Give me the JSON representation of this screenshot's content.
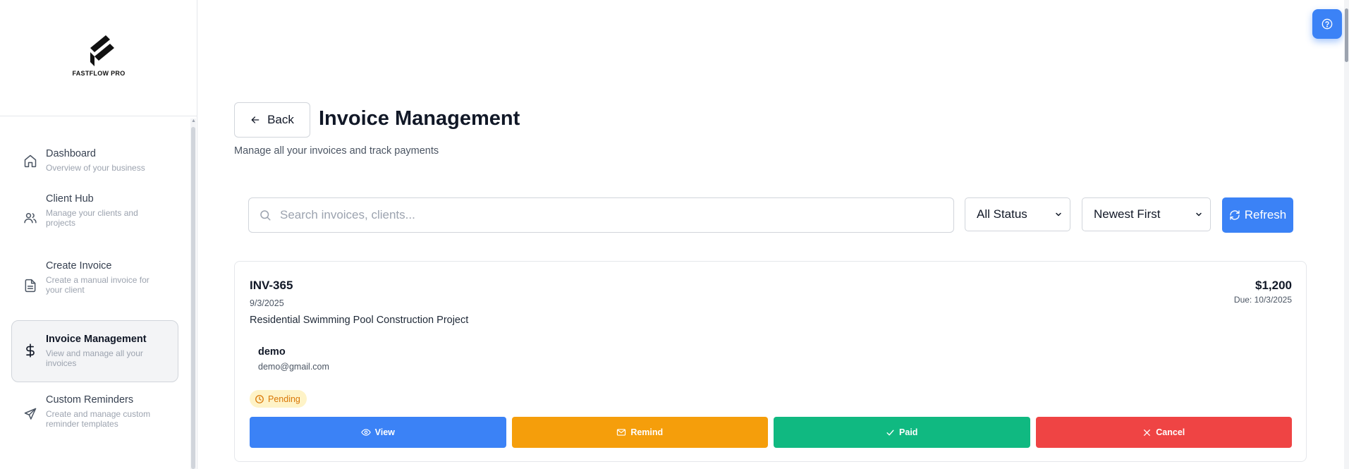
{
  "brand": {
    "name": "FASTFLOW PRO"
  },
  "sidebar": {
    "items": [
      {
        "title": "Dashboard",
        "desc": "Overview of your business",
        "icon": "home-icon",
        "active": false
      },
      {
        "title": "Client Hub",
        "desc": "Manage your clients and projects",
        "icon": "users-icon",
        "active": false
      },
      {
        "title": "Create Invoice",
        "desc": "Create a manual invoice for your client",
        "icon": "file-text-icon",
        "active": false
      },
      {
        "title": "Invoice Management",
        "desc": "View and manage all your invoices",
        "icon": "dollar-sign-icon",
        "active": true
      },
      {
        "title": "Custom Reminders",
        "desc": "Create and manage custom reminder templates",
        "icon": "send-icon",
        "active": false
      }
    ]
  },
  "header": {
    "back_label": "Back",
    "title": "Invoice Management",
    "subtitle": "Manage all your invoices and track payments"
  },
  "filters": {
    "search_placeholder": "Search invoices, clients...",
    "status_value": "All Status",
    "sort_value": "Newest First",
    "refresh_label": "Refresh"
  },
  "invoice": {
    "number": "INV-365",
    "date": "9/3/2025",
    "project": "Residential Swimming Pool Construction Project",
    "amount": "$1,200",
    "due": "Due: 10/3/2025",
    "client_name": "demo",
    "client_email": "demo@gmail.com",
    "status": "Pending",
    "actions": {
      "view": "View",
      "remind": "Remind",
      "paid": "Paid",
      "cancel": "Cancel"
    }
  },
  "colors": {
    "primary": "#3b82f6",
    "warning": "#f59e0b",
    "success": "#10b981",
    "danger": "#ef4444",
    "pending_bg": "#fef3c7",
    "pending_text": "#d97706"
  }
}
